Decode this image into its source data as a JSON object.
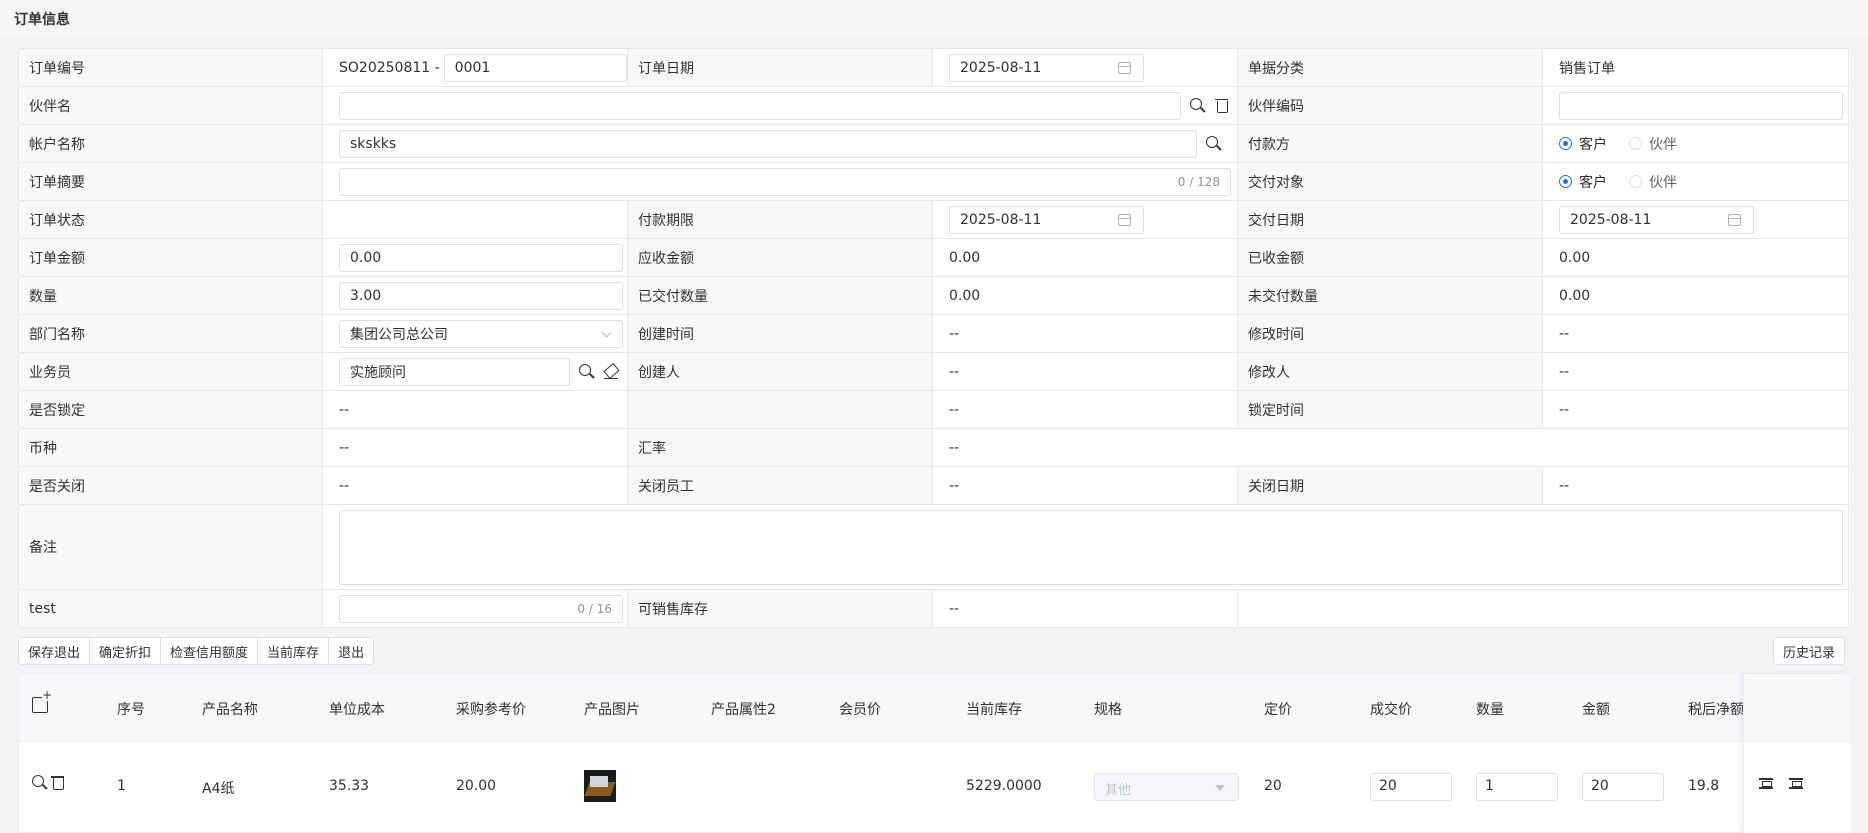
{
  "page": {
    "title": "订单信息"
  },
  "form": {
    "order_no_label": "订单编号",
    "order_no_prefix": "SO20250811 -",
    "order_no_suffix": "0001",
    "order_date_label": "订单日期",
    "order_date": "2025-08-11",
    "doc_type_label": "单据分类",
    "doc_type": "销售订单",
    "partner_name_label": "伙伴名",
    "partner_name": "",
    "partner_code_label": "伙伴编码",
    "partner_code": "",
    "account_name_label": "帐户名称",
    "account_name": "skskks",
    "payer_label": "付款方",
    "payer_options": [
      "客户",
      "伙伴"
    ],
    "summary_label": "订单摘要",
    "summary_counter": "0 / 128",
    "delivery_target_label": "交付对象",
    "delivery_options": [
      "客户",
      "伙伴"
    ],
    "status_label": "订单状态",
    "status": "",
    "pay_term_label": "付款期限",
    "pay_term": "2025-08-11",
    "delivery_date_label": "交付日期",
    "delivery_date": "2025-08-11",
    "amount_label": "订单金额",
    "amount": "0.00",
    "receivable_label": "应收金额",
    "receivable": "0.00",
    "received_label": "已收金额",
    "received": "0.00",
    "qty_label": "数量",
    "qty": "3.00",
    "delivered_qty_label": "已交付数量",
    "delivered_qty": "0.00",
    "undelivered_qty_label": "未交付数量",
    "undelivered_qty": "0.00",
    "dept_label": "部门名称",
    "dept": "集团公司总公司",
    "created_time_label": "创建时间",
    "created_time": "--",
    "modified_time_label": "修改时间",
    "modified_time": "--",
    "salesman_label": "业务员",
    "salesman": "实施顾问",
    "creator_label": "创建人",
    "creator": "--",
    "modifier_label": "修改人",
    "modifier": "--",
    "locked_label": "是否锁定",
    "locked": "--",
    "blank_label": "",
    "blank_val": "--",
    "lock_time_label": "锁定时间",
    "lock_time": "--",
    "currency_label": "币种",
    "currency": "--",
    "rate_label": "汇率",
    "rate": "--",
    "closed_label": "是否关闭",
    "closed": "--",
    "close_staff_label": "关闭员工",
    "close_staff": "--",
    "close_date_label": "关闭日期",
    "close_date": "--",
    "remark_label": "备注",
    "remark": "",
    "test_label": "test",
    "test_counter": "0 / 16",
    "sellable_label": "可销售库存",
    "sellable": "--"
  },
  "toolbar": {
    "buttons": [
      "保存退出",
      "确定折扣",
      "检查信用额度",
      "当前库存",
      "退出"
    ],
    "history": "历史记录"
  },
  "table": {
    "headers": [
      "序号",
      "产品名称",
      "单位成本",
      "采购参考价",
      "产品图片",
      "产品属性2",
      "会员价",
      "当前库存",
      "规格",
      "定价",
      "成交价",
      "数量",
      "金额",
      "税后净额"
    ],
    "rows": [
      {
        "seq": "1",
        "name": "A4纸",
        "unit_cost": "35.33",
        "purchase_ref": "20.00",
        "stock": "5229.0000",
        "spec": "其他",
        "price": "20",
        "deal_price": "20",
        "qty": "1",
        "amount": "20",
        "net": "19.8"
      }
    ]
  }
}
